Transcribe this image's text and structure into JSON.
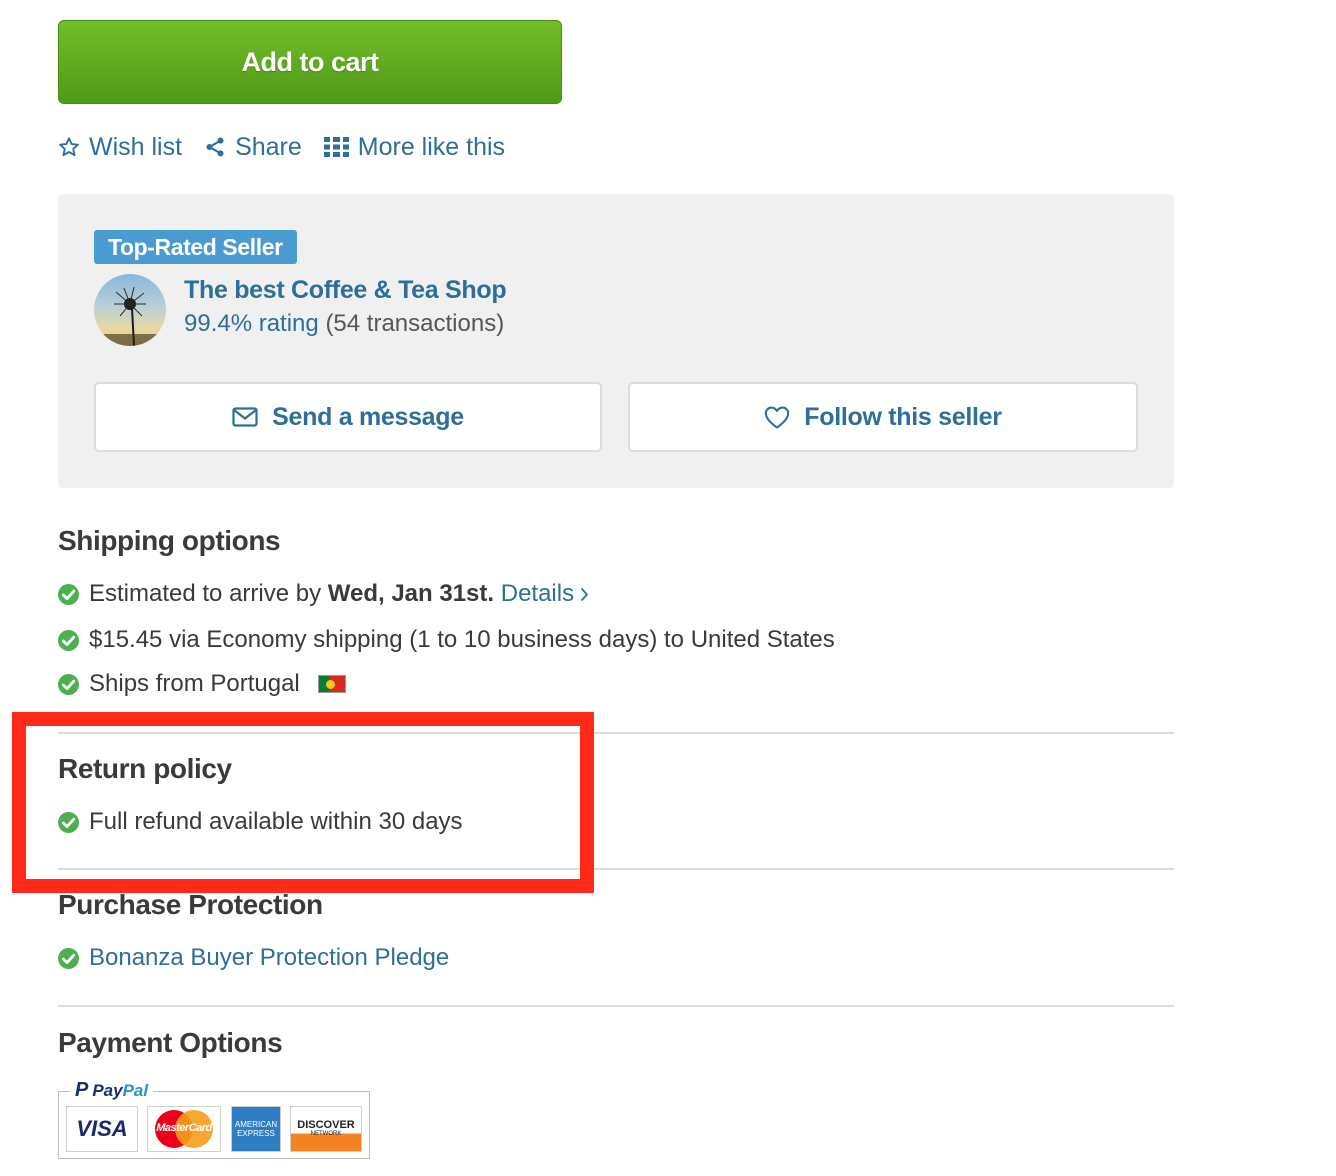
{
  "add_to_cart": {
    "label": "Add to cart"
  },
  "actions": [
    {
      "label": "Wish list",
      "icon": "star-outline-icon"
    },
    {
      "label": "Share",
      "icon": "share-icon"
    },
    {
      "label": "More like this",
      "icon": "grid-icon"
    }
  ],
  "seller": {
    "badge": "Top-Rated Seller",
    "name": "The best Coffee & Tea Shop",
    "rating": "99.4% rating",
    "transactions": "(54 transactions)",
    "message_label": "Send a message",
    "follow_label": "Follow this seller"
  },
  "shipping": {
    "title": "Shipping options",
    "arrival_prefix": "Estimated to arrive by",
    "arrival_date": "Wed, Jan 31st.",
    "details_label": "Details",
    "cost": "$15.45 via Economy shipping (1 to 10 business days) to United States",
    "ships_from": "Ships from Portugal"
  },
  "returns": {
    "title": "Return policy",
    "item": "Full refund available within 30 days"
  },
  "protection": {
    "title": "Purchase Protection",
    "item": "Bonanza Buyer Protection Pledge"
  },
  "payment": {
    "title": "Payment Options",
    "paypal_pay": "Pay",
    "paypal_pal": "Pal",
    "cards": {
      "visa": "VISA",
      "mastercard": "MasterCard",
      "amex": "AMERICAN EXPRESS",
      "discover": "DISCOVER",
      "discover_sub": "NETWORK"
    }
  },
  "colors": {
    "accent_green": "#5fae20",
    "link_blue": "#2e6e9a",
    "badge_blue": "#4a9bd1",
    "check_green": "#4caf50",
    "highlight_red": "#ff2a1a"
  }
}
